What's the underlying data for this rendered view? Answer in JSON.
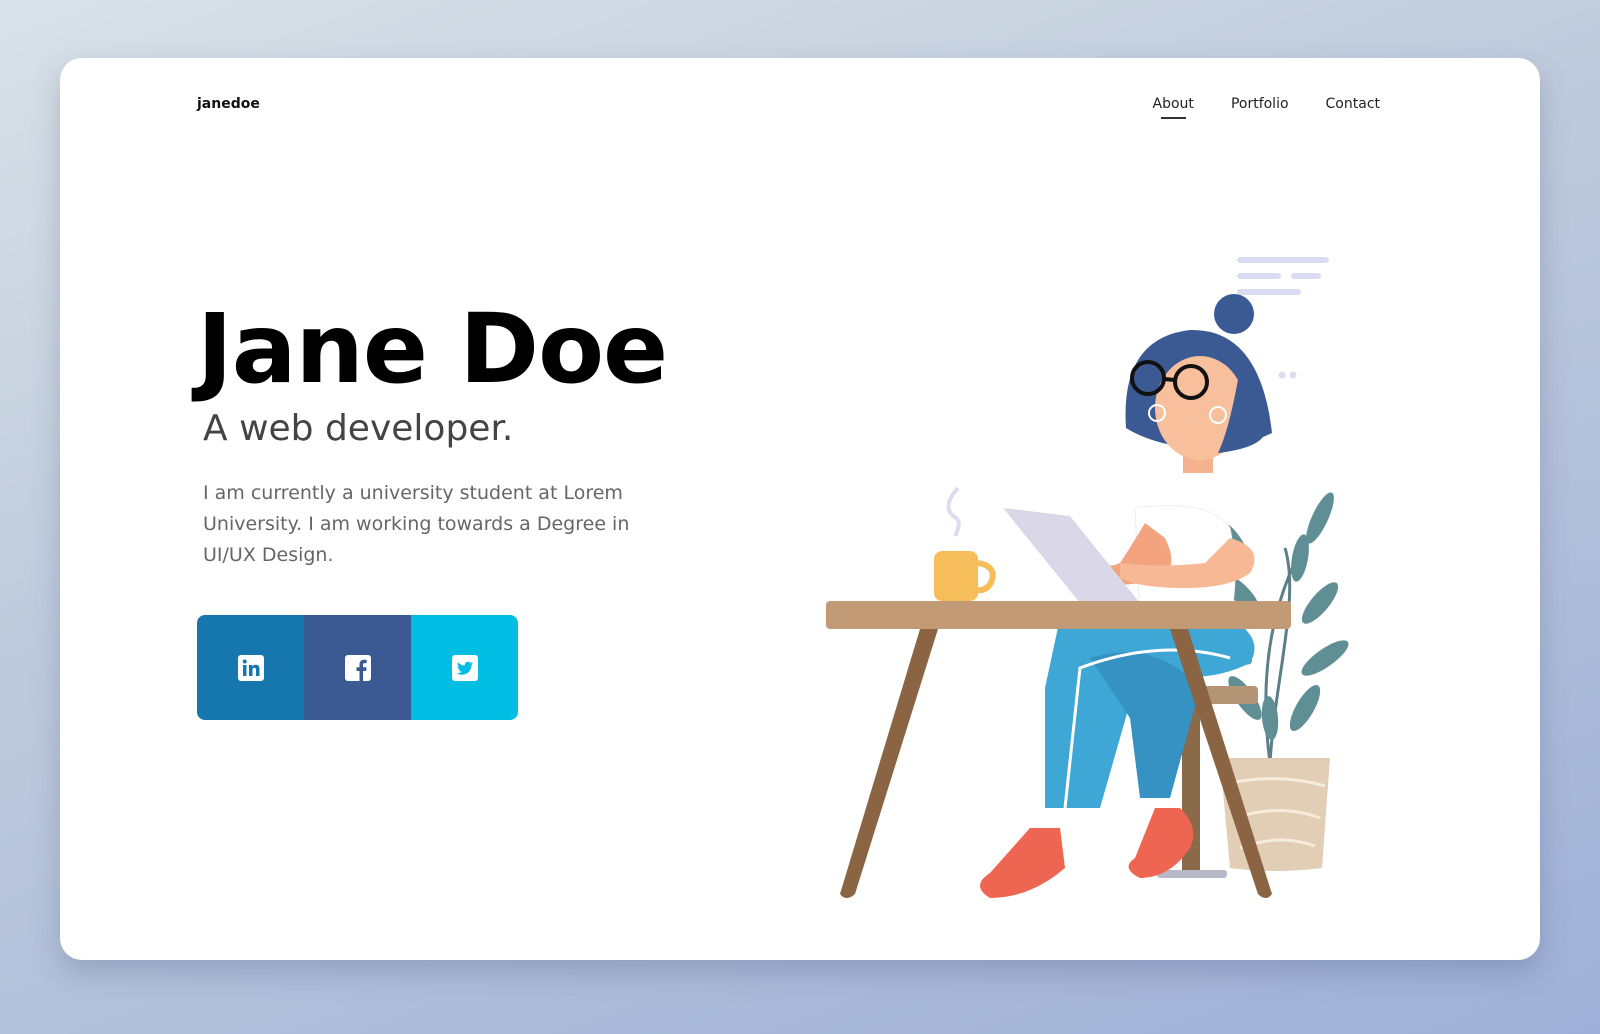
{
  "header": {
    "logo": "janedoe",
    "nav": [
      {
        "label": "About",
        "active": true
      },
      {
        "label": "Portfolio",
        "active": false
      },
      {
        "label": "Contact",
        "active": false
      }
    ]
  },
  "hero": {
    "title": "Jane Doe",
    "subtitle": "A web developer.",
    "bio": "I am currently a university student at  Lorem University. I am working towards a Degree in UI/UX Design."
  },
  "social": [
    {
      "name": "linkedin",
      "icon": "linkedin-icon",
      "color": "#1577ad"
    },
    {
      "name": "facebook",
      "icon": "facebook-icon",
      "color": "#3b5a94"
    },
    {
      "name": "twitter",
      "icon": "twitter-icon",
      "color": "#00bde3"
    }
  ],
  "colors": {
    "background_start": "#d9e1e8",
    "background_end": "#9fb0d8",
    "card": "#ffffff",
    "title": "#000000",
    "subtitle": "#444444",
    "body": "#666666"
  }
}
